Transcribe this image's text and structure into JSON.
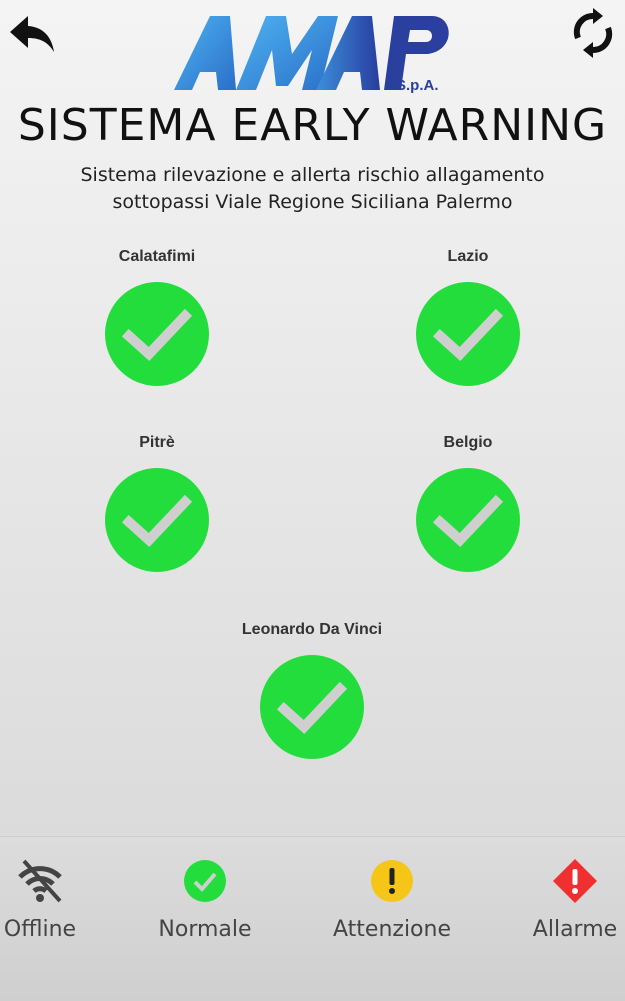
{
  "header": {
    "logo_text": "AMAP",
    "logo_suffix": "S.p.A.",
    "title": "SISTEMA EARLY WARNING",
    "subtitle_line1": "Sistema rilevazione e allerta rischio allagamento",
    "subtitle_line2": "sottopassi Viale Regione Siciliana Palermo"
  },
  "icons": {
    "back": "back-arrow-icon",
    "refresh": "refresh-icon"
  },
  "stations": [
    {
      "name": "Calatafimi",
      "status": "Normale"
    },
    {
      "name": "Lazio",
      "status": "Normale"
    },
    {
      "name": "Pitrè",
      "status": "Normale"
    },
    {
      "name": "Belgio",
      "status": "Normale"
    },
    {
      "name": "Leonardo Da Vinci",
      "status": "Normale"
    }
  ],
  "legend": [
    {
      "label": "Offline",
      "icon": "wifi-off-icon"
    },
    {
      "label": "Normale",
      "icon": "check-circle-icon",
      "color": "#22dd3c"
    },
    {
      "label": "Attenzione",
      "icon": "warning-circle-icon",
      "color": "#f5c518"
    },
    {
      "label": "Allarme",
      "icon": "alarm-diamond-icon",
      "color": "#f03030"
    }
  ],
  "colors": {
    "normal": "#22dd3c",
    "attention": "#f5c518",
    "alarm": "#f03030",
    "logo_blue": "#2e8fd8",
    "logo_dark_blue": "#2a3f9e"
  }
}
